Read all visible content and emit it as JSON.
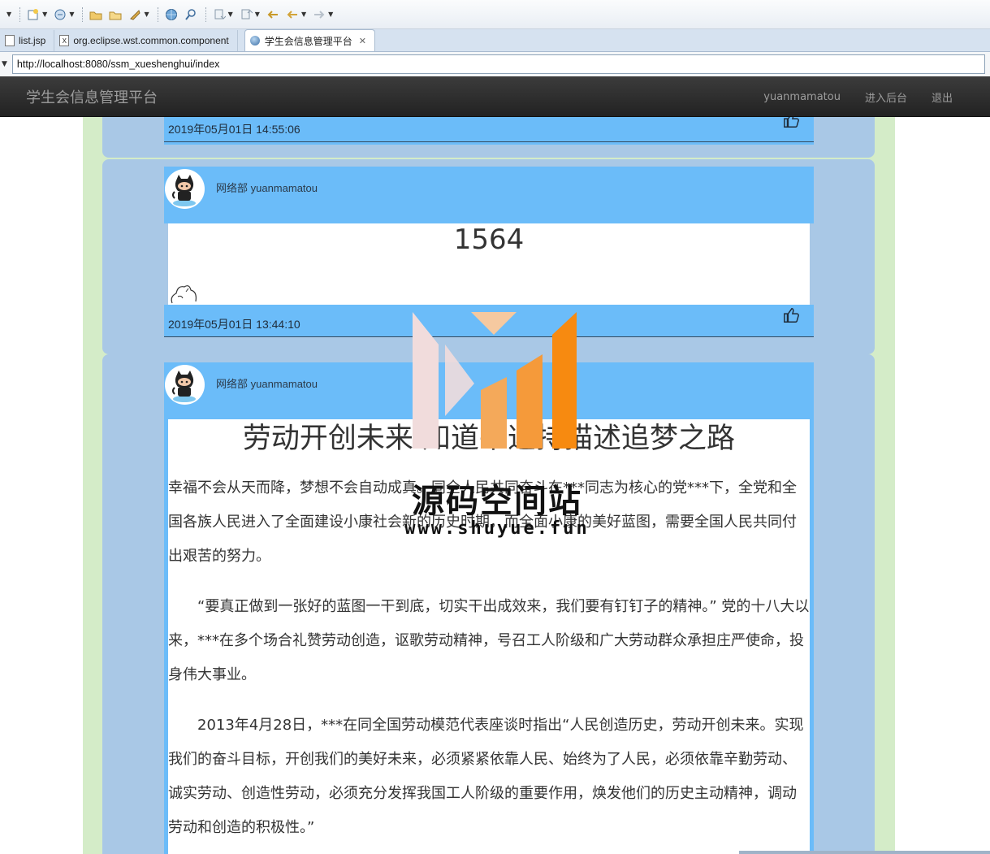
{
  "tabs": [
    {
      "label": "list.jsp",
      "active": false
    },
    {
      "label": "org.eclipse.wst.common.component",
      "active": false
    },
    {
      "label": "学生会信息管理平台",
      "active": true
    }
  ],
  "address": {
    "url": "http://localhost:8080/ssm_xueshenghui/index"
  },
  "navbar": {
    "brand": "学生会信息管理平台",
    "links": [
      "yuanmamatou",
      "进入后台",
      "退出"
    ]
  },
  "posts": [
    {
      "date": "2019年05月01日 14:55:06"
    },
    {
      "author": "网络部 yuanmamatou",
      "title": "1564",
      "date": "2019年05月01日 13:44:10"
    },
    {
      "author": "网络部 yuanmamatou",
      "title": "劳动开创未来 知道平述持描述追梦之路",
      "paragraphs": [
        "幸福不会从天而降，梦想不会自动成真。同全人民共同奋斗在***同志为核心的党***下，全党和全国各族人民进入了全面建设小康社会新的历史时期，而全面小康的美好蓝图，需要全国人民共同付出艰苦的努力。",
        "“要真正做到一张好的蓝图一干到底，切实干出成效来，我们要有钉钉子的精神。” 党的十八大以来，***在多个场合礼赞劳动创造，讴歌劳动精神，号召工人阶级和广大劳动群众承担庄严使命，投身伟大事业。",
        "2013年4月28日，***在同全国劳动模范代表座谈时指出“人民创造历史，劳动开创未来。实现我们的奋斗目标，开创我们的美好未来，必须紧紧依靠人民、始终为了人民，必须依靠辛勤劳动、诚实劳动、创造性劳动，必须充分发挥我国工人阶级的重要作用，焕发他们的历史主动精神，调动劳动和创造的积极性。”"
      ]
    }
  ],
  "watermark": {
    "title": "源码空间站",
    "url": "www.shuyue.fun"
  },
  "icons": [
    "new-icon",
    "debug-icon",
    "open-icon",
    "run-icon",
    "globe-icon",
    "search-icon",
    "back-icon",
    "forward-icon",
    "like-icon"
  ],
  "colors": {
    "navbar": "#222222",
    "card": "#a9c8e6",
    "post_bg": "#6bbcf9",
    "page_bg": "#d4ecc8"
  }
}
